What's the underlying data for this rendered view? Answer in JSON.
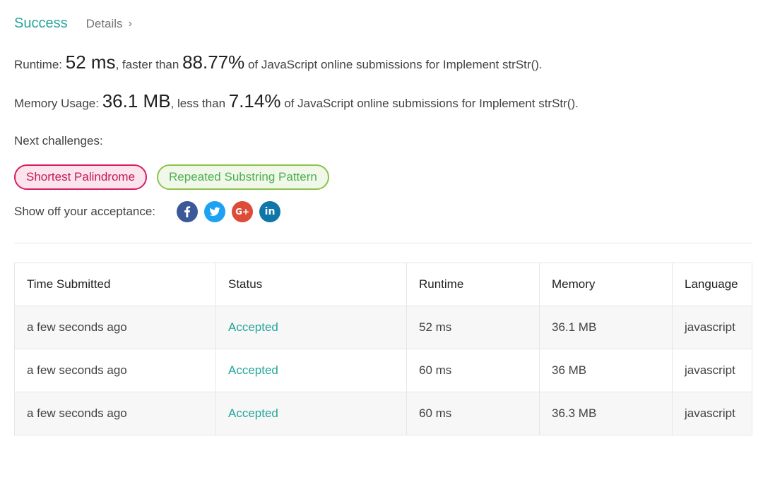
{
  "header": {
    "status": "Success",
    "details_label": "Details",
    "details_chevron": "›"
  },
  "runtime": {
    "label": "Runtime: ",
    "value": "52 ms",
    "mid": ", faster than ",
    "percent": "88.77%",
    "suffix": " of JavaScript online submissions for Implement strStr()."
  },
  "memory": {
    "label": "Memory Usage: ",
    "value": "36.1 MB",
    "mid": ", less than ",
    "percent": "7.14%",
    "suffix": " of JavaScript online submissions for Implement strStr()."
  },
  "next_challenges": {
    "label": "Next challenges:",
    "items": [
      {
        "label": "Shortest Palindrome",
        "difficulty_color": "#d81b60"
      },
      {
        "label": "Repeated Substring Pattern",
        "difficulty_color": "#8bc34a"
      }
    ]
  },
  "share": {
    "label": "Show off your acceptance:",
    "icons": [
      "facebook-icon",
      "twitter-icon",
      "google-plus-icon",
      "linkedin-icon"
    ],
    "gplus_text": "G+",
    "linkedin_text": "in"
  },
  "table": {
    "headers": [
      "Time Submitted",
      "Status",
      "Runtime",
      "Memory",
      "Language"
    ],
    "rows": [
      {
        "time": "a few seconds ago",
        "status": "Accepted",
        "runtime": "52 ms",
        "memory": "36.1 MB",
        "language": "javascript"
      },
      {
        "time": "a few seconds ago",
        "status": "Accepted",
        "runtime": "60 ms",
        "memory": "36 MB",
        "language": "javascript"
      },
      {
        "time": "a few seconds ago",
        "status": "Accepted",
        "runtime": "60 ms",
        "memory": "36.3 MB",
        "language": "javascript"
      }
    ]
  },
  "colors": {
    "accent": "#26a69a",
    "hard": "#d81b60",
    "easy": "#8bc34a"
  }
}
